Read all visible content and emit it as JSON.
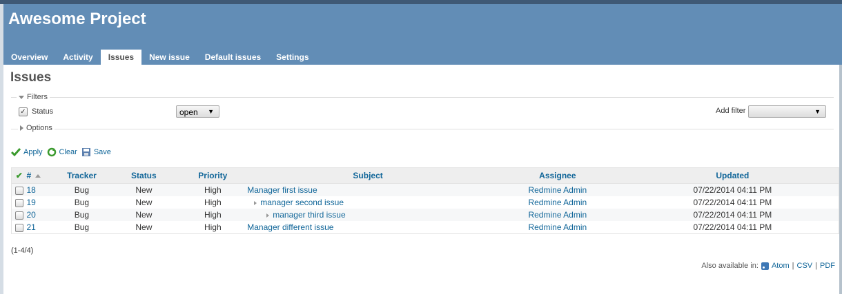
{
  "project": {
    "title": "Awesome Project"
  },
  "tabs": [
    {
      "label": "Overview"
    },
    {
      "label": "Activity"
    },
    {
      "label": "Issues",
      "selected": true
    },
    {
      "label": "New issue"
    },
    {
      "label": "Default issues"
    },
    {
      "label": "Settings"
    }
  ],
  "page": {
    "title": "Issues"
  },
  "filters": {
    "legend": "Filters",
    "status_label": "Status",
    "status_checked": true,
    "status_value": "open",
    "add_filter_label": "Add filter",
    "add_filter_value": ""
  },
  "options": {
    "legend": "Options"
  },
  "actions": {
    "apply": "Apply",
    "clear": "Clear",
    "save": "Save"
  },
  "table": {
    "columns": [
      "#",
      "Tracker",
      "Status",
      "Priority",
      "Subject",
      "Assignee",
      "Updated"
    ],
    "rows": [
      {
        "id": "18",
        "tracker": "Bug",
        "status": "New",
        "priority": "High",
        "subject": "Manager first issue",
        "level": 0,
        "assignee": "Redmine Admin",
        "updated": "07/22/2014 04:11 PM"
      },
      {
        "id": "19",
        "tracker": "Bug",
        "status": "New",
        "priority": "High",
        "subject": "manager second issue",
        "level": 1,
        "assignee": "Redmine Admin",
        "updated": "07/22/2014 04:11 PM"
      },
      {
        "id": "20",
        "tracker": "Bug",
        "status": "New",
        "priority": "High",
        "subject": "manager third issue",
        "level": 2,
        "assignee": "Redmine Admin",
        "updated": "07/22/2014 04:11 PM"
      },
      {
        "id": "21",
        "tracker": "Bug",
        "status": "New",
        "priority": "High",
        "subject": "Manager different issue",
        "level": 0,
        "assignee": "Redmine Admin",
        "updated": "07/22/2014 04:11 PM"
      }
    ]
  },
  "pagination": {
    "count": "(1-4/4)"
  },
  "other_formats": {
    "label": "Also available in:",
    "atom": "Atom",
    "sep1": "|",
    "csv": "CSV",
    "sep2": "|",
    "pdf": "PDF"
  },
  "colors": {
    "header": "#628db6",
    "link": "#116699",
    "topline": "#3f5975"
  }
}
